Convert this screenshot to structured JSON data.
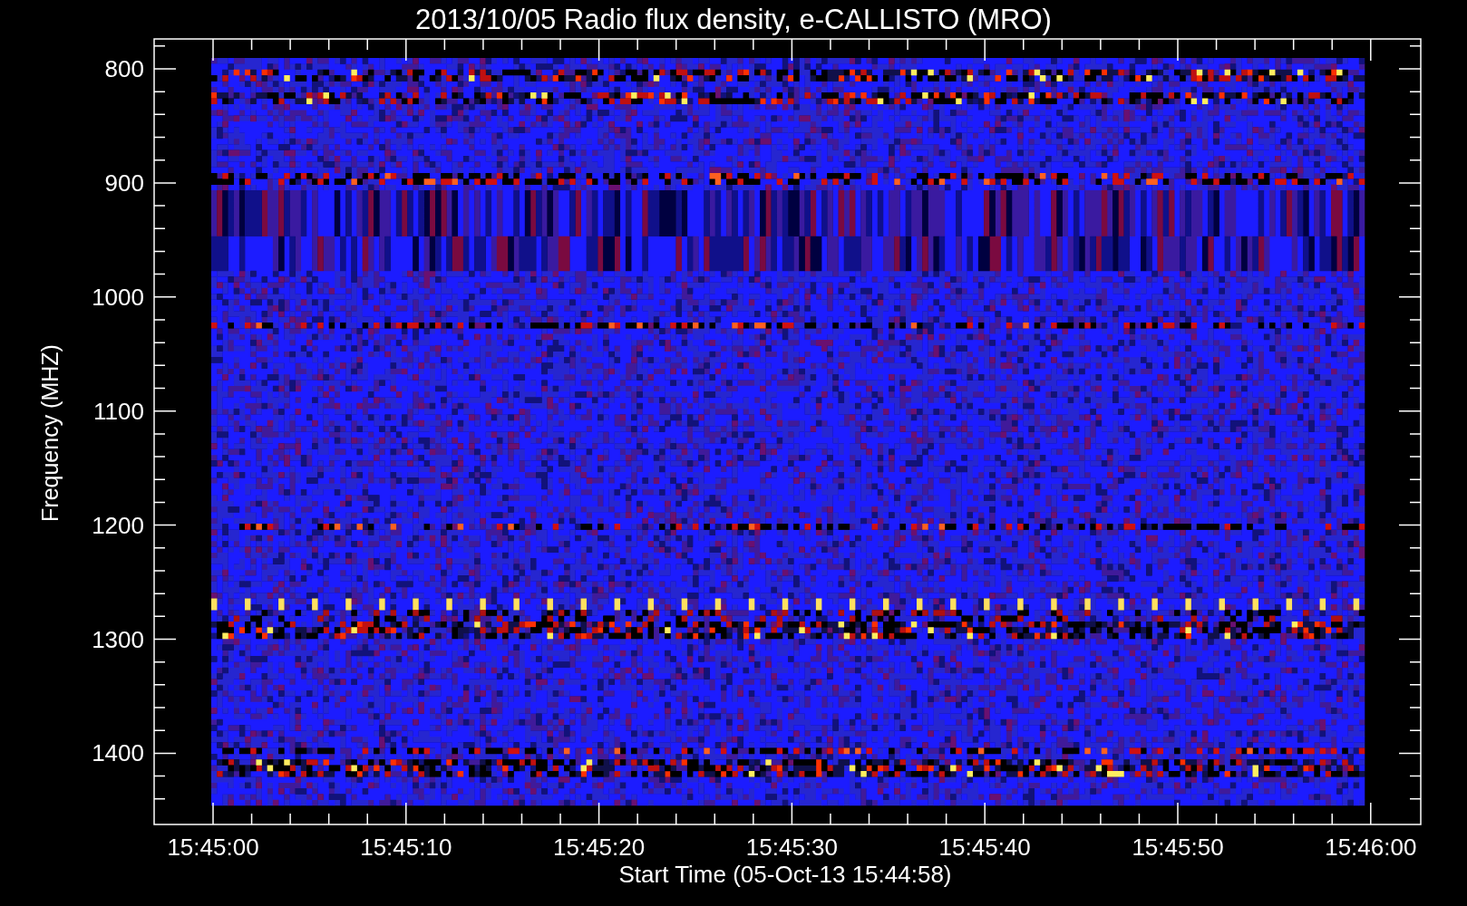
{
  "plot": {
    "title": "2013/10/05  Radio flux density, e-CALLISTO (MRO)",
    "ylabel": "Frequency (MHZ)",
    "xlabel": "Start Time (05-Oct-13 15:44:58)",
    "yticks": [
      "800",
      "900",
      "1000",
      "1100",
      "1200",
      "1300",
      "1400"
    ],
    "xticks": [
      "15:45:00",
      "15:45:10",
      "15:45:20",
      "15:45:30",
      "15:45:40",
      "15:45:50",
      "15:46:00"
    ]
  }
}
